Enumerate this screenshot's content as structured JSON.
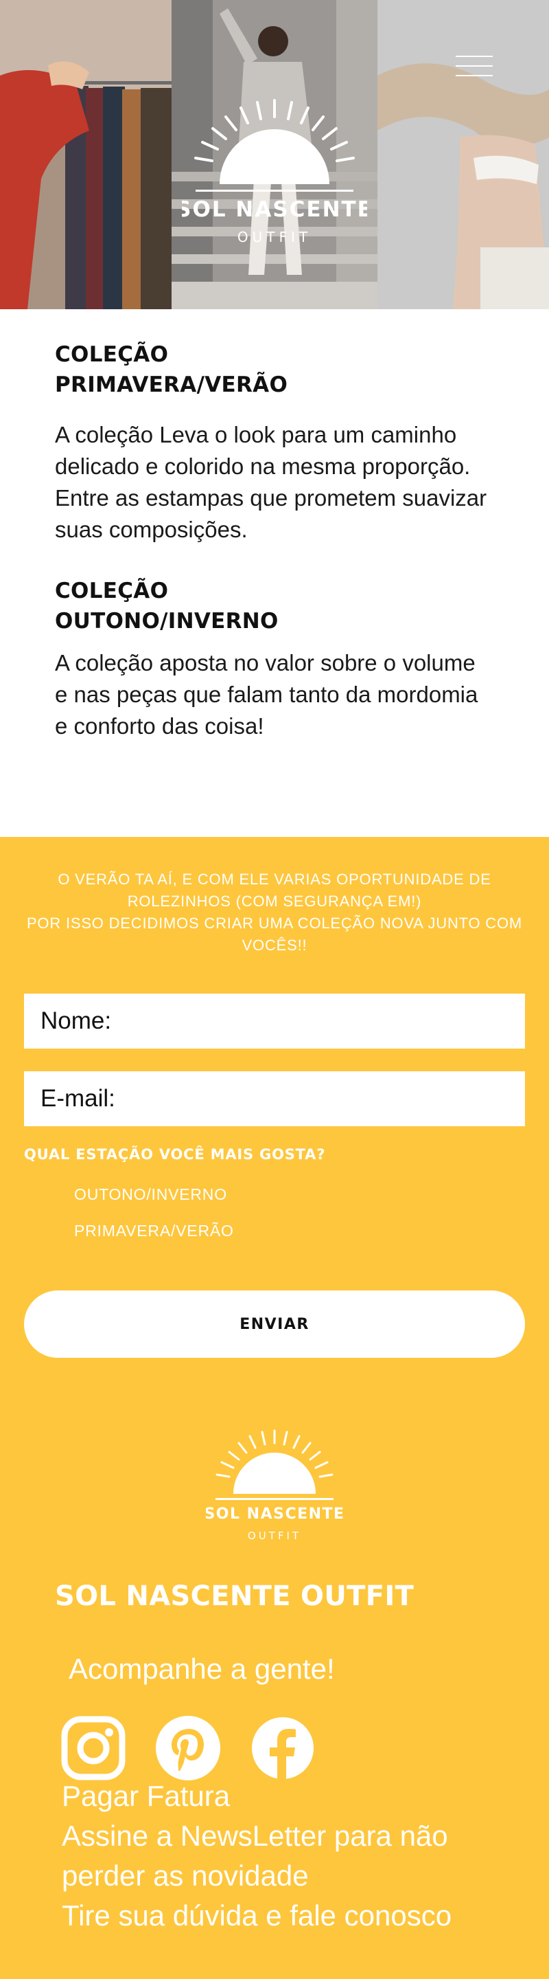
{
  "brand": {
    "name": "SOL NASCENTE",
    "sub": "OUTFIT"
  },
  "collections": [
    {
      "title_line1": "COLEÇÃO",
      "title_line2": "PRIMAVERA/VERÃO",
      "body": "A coleção Leva o look para um caminho delicado e colorido na mesma proporção. Entre as estampas que prometem suavizar suas composições."
    },
    {
      "title_line1": "COLEÇÃO",
      "title_line2": "OUTONO/INVERNO",
      "body": "A coleção aposta no valor sobre o volume e nas peças que falam tanto da mordomia e conforto das coisa!"
    }
  ],
  "promo": {
    "line1": "O VERÃO TA AÍ, E COM ELE VARIAS OPORTUNIDADE DE ROLEZINHOS (COM SEGURANÇA EM!)",
    "line2": "POR ISSO DECIDIMOS CRIAR UMA COLEÇÃO NOVA JUNTO COM VOCÊS!!"
  },
  "form": {
    "name_placeholder": "Nome:",
    "email_placeholder": "E-mail:",
    "question": "QUAL ESTAÇÃO VOCÊ MAIS GOSTA?",
    "options": [
      "OUTONO/INVERNO",
      "PRIMAVERA/VERÃO"
    ],
    "submit_label": "ENVIAR"
  },
  "footer": {
    "title": "SOL NASCENTE OUTFIT",
    "follow": "Acompanhe a gente!",
    "social_icons": [
      "instagram-icon",
      "pinterest-icon",
      "facebook-icon"
    ],
    "links": [
      "Pagar Fatura",
      "Assine a NewsLetter para  não perder as novidade",
      "Tire sua dúvida e fale conosco"
    ]
  },
  "colors": {
    "accent_yellow": "#fec63d",
    "white": "#ffffff",
    "text_dark": "#111111"
  }
}
